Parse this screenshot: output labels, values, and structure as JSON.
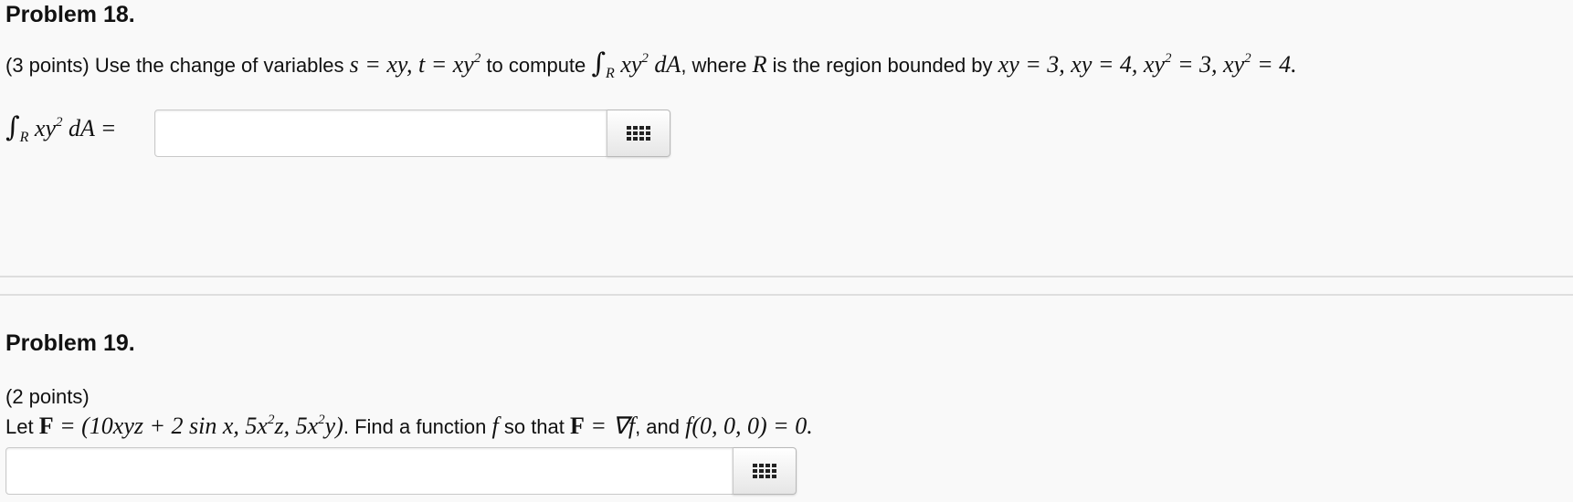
{
  "problem18": {
    "title": "Problem 18.",
    "intro": "(3 points) Use the change of variables ",
    "sub_s": "s = xy, t = xy",
    "to_compute": " to compute ",
    "integrand": "xy",
    "dA": " dA",
    "where": ", where ",
    "R": "R",
    "region_text": " is the region bounded by ",
    "bounds": "xy = 3,  xy = 4,  xy",
    "bounds2": " = 3,  xy",
    "bounds3": " = 4.",
    "answer_label_integrand": "xy",
    "answer_label_rest": " dA =",
    "answer_value": ""
  },
  "problem19": {
    "title": "Problem 19.",
    "points": "(2 points)",
    "let": "Let ",
    "F": "F",
    "eq_vector": " = (10xyz + 2 sin x, 5x",
    "mid1": "z, 5x",
    "mid2": "y)",
    "find": ". Find a function ",
    "f": "f",
    "so_that": " so that ",
    "eq_grad": " = ∇f",
    "and": ", and ",
    "cond": "f(0, 0, 0) = 0.",
    "answer_value": ""
  },
  "icons": {
    "palette": "equation-palette-icon"
  }
}
